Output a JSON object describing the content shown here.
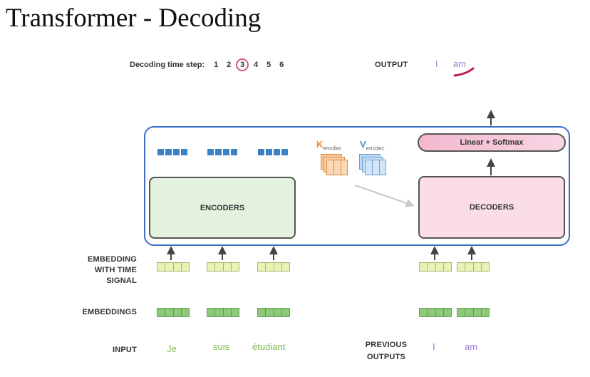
{
  "title": "Transformer - Decoding",
  "timestep": {
    "label": "Decoding time step:",
    "steps": [
      "1",
      "2",
      "3",
      "4",
      "5",
      "6"
    ],
    "active": "3"
  },
  "output": {
    "label": "OUTPUT",
    "words": [
      "I",
      "am"
    ]
  },
  "blocks": {
    "encoders": "ENCODERS",
    "decoders": "DECODERS",
    "linear_softmax": "Linear + Softmax"
  },
  "kv": {
    "k_letter": "K",
    "k_sub": "encdec",
    "v_letter": "V",
    "v_sub": "encdec"
  },
  "row_labels": {
    "embedding_time_signal": [
      "EMBEDDING",
      "WITH TIME",
      "SIGNAL"
    ],
    "embeddings": "EMBEDDINGS",
    "input": "INPUT",
    "previous_outputs": [
      "PREVIOUS",
      "OUTPUTS"
    ]
  },
  "input_words": [
    "Je",
    "suis",
    "étudiant"
  ],
  "previous_output_words": [
    "I",
    "am"
  ],
  "colors": {
    "outer_border": "#3d6fc9",
    "encoder_fill": "#e4f1de",
    "decoder_fill": "#fadde9",
    "vector_blue": "#3b82c4",
    "input_word": "#7fb84e",
    "output_word": "#9b7fd4",
    "highlight": "#d2568c",
    "k_color": "#e8893a",
    "v_color": "#4a90d9"
  }
}
